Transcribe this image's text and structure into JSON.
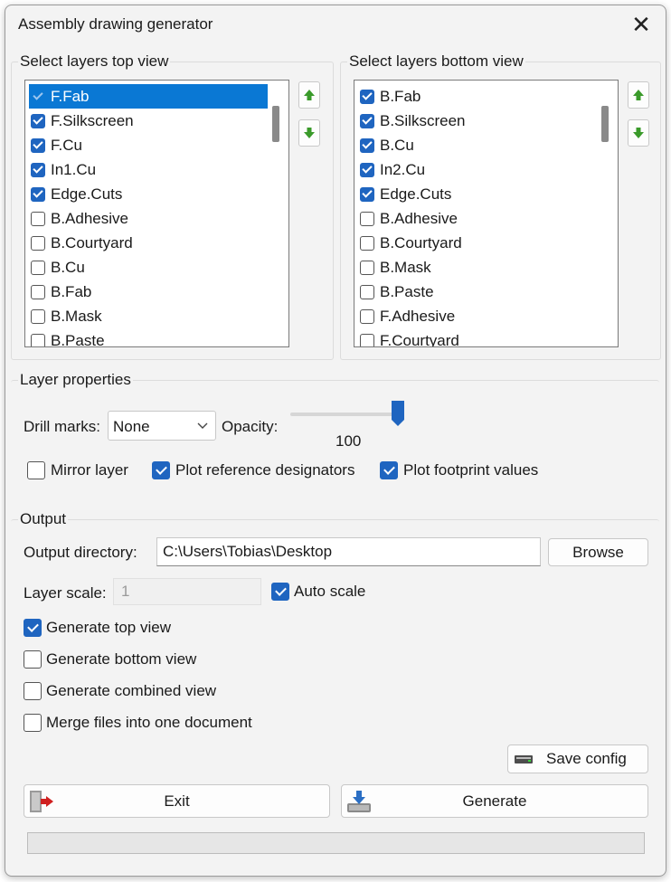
{
  "window": {
    "title": "Assembly drawing generator"
  },
  "top_view": {
    "label": "Select layers top view",
    "items": [
      {
        "label": "F.Fab",
        "checked": true,
        "selected": true
      },
      {
        "label": "F.Silkscreen",
        "checked": true
      },
      {
        "label": "F.Cu",
        "checked": true
      },
      {
        "label": "In1.Cu",
        "checked": true
      },
      {
        "label": "Edge.Cuts",
        "checked": true
      },
      {
        "label": "B.Adhesive",
        "checked": false
      },
      {
        "label": "B.Courtyard",
        "checked": false
      },
      {
        "label": "B.Cu",
        "checked": false
      },
      {
        "label": "B.Fab",
        "checked": false
      },
      {
        "label": "B.Mask",
        "checked": false
      },
      {
        "label": "B.Paste",
        "checked": false
      }
    ]
  },
  "bottom_view": {
    "label": "Select layers bottom view",
    "items": [
      {
        "label": "B.Fab",
        "checked": true
      },
      {
        "label": "B.Silkscreen",
        "checked": true
      },
      {
        "label": "B.Cu",
        "checked": true
      },
      {
        "label": "In2.Cu",
        "checked": true
      },
      {
        "label": "Edge.Cuts",
        "checked": true
      },
      {
        "label": "B.Adhesive",
        "checked": false
      },
      {
        "label": "B.Courtyard",
        "checked": false
      },
      {
        "label": "B.Mask",
        "checked": false
      },
      {
        "label": "B.Paste",
        "checked": false
      },
      {
        "label": "F.Adhesive",
        "checked": false
      },
      {
        "label": "F.Courtyard",
        "checked": false
      }
    ]
  },
  "layer_properties": {
    "label": "Layer properties",
    "drill_marks_label": "Drill marks:",
    "drill_marks_value": "None",
    "opacity_label": "Opacity:",
    "opacity_value": "100",
    "mirror_layer": {
      "label": "Mirror layer",
      "checked": false
    },
    "plot_ref": {
      "label": "Plot reference designators",
      "checked": true
    },
    "plot_values": {
      "label": "Plot footprint values",
      "checked": true
    }
  },
  "output": {
    "label": "Output",
    "directory_label": "Output directory:",
    "directory_value": "C:\\Users\\Tobias\\Desktop",
    "browse_label": "Browse",
    "scale_label": "Layer scale:",
    "scale_value": "1",
    "auto_scale": {
      "label": "Auto scale",
      "checked": true
    },
    "gen_top": {
      "label": "Generate top view",
      "checked": true
    },
    "gen_bottom": {
      "label": "Generate bottom view",
      "checked": false
    },
    "gen_combined": {
      "label": "Generate combined view",
      "checked": false
    },
    "merge": {
      "label": "Merge files into one document",
      "checked": false
    },
    "save_config_label": "Save config"
  },
  "buttons": {
    "exit_label": "Exit",
    "generate_label": "Generate"
  },
  "progress": {
    "value": 0
  },
  "icons": {
    "close": "close-icon",
    "up": "arrow-up-icon",
    "down": "arrow-down-icon",
    "save": "save-config-icon",
    "exit": "exit-door-icon",
    "generate": "generate-icon"
  },
  "colors": {
    "accent": "#1f65c0",
    "selection": "#0a78d4",
    "arrow_green": "#3a9a2a"
  }
}
